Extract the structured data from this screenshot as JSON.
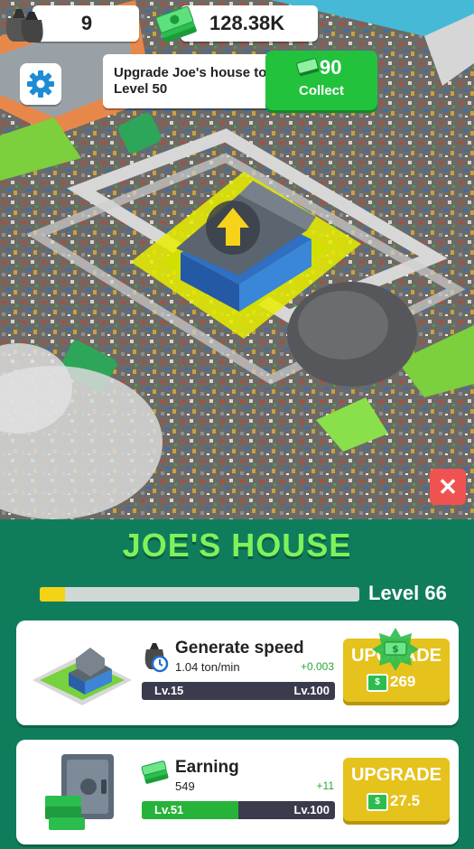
{
  "hud": {
    "bags_count": "9",
    "cash": "128.38K"
  },
  "quest": {
    "text": "Upgrade Joe's house to Level 50",
    "reward": "90",
    "collect_label": "Collect"
  },
  "panel": {
    "title": "JOE'S HOUSE",
    "level_label": "Level 66",
    "level_progress": 0.08
  },
  "cards": [
    {
      "title": "Generate speed",
      "value": "1.04 ton/min",
      "delta": "+0.003",
      "lv_current": "Lv.15",
      "lv_max": "Lv.100",
      "progress": 0.0,
      "upgrade_label": "UPGRADE",
      "cost": "269"
    },
    {
      "title": "Earning",
      "value": "549",
      "delta": "+11",
      "lv_current": "Lv.51",
      "lv_max": "Lv.100",
      "progress": 0.5,
      "upgrade_label": "UPGRADE",
      "cost": "27.5"
    }
  ],
  "colors": {
    "panel_bg": "#0f7d5c",
    "title_green": "#7ef25a",
    "upgrade_yellow": "#e5c21c",
    "collect_green": "#22c23c",
    "close_red": "#f05252"
  }
}
